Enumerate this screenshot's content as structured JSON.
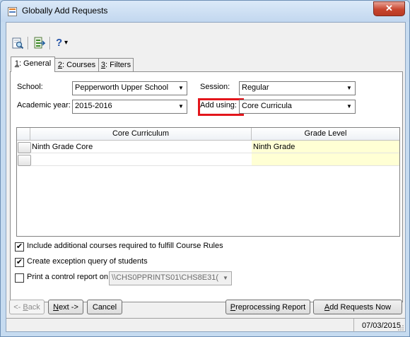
{
  "window": {
    "title": "Globally Add Requests",
    "close_glyph": "✕"
  },
  "toolbar": {
    "help_glyph": "?",
    "help_dropdown_glyph": "▾"
  },
  "tabs": [
    {
      "hotkey": "1",
      "label": ": General"
    },
    {
      "hotkey": "2",
      "label": ": Courses"
    },
    {
      "hotkey": "3",
      "label": ": Filters"
    }
  ],
  "form": {
    "school_label": "School:",
    "school_value": "Pepperworth Upper School",
    "session_label": "Session:",
    "session_value": "Regular",
    "academic_year_label": "Academic year:",
    "academic_year_value": "2015-2016",
    "add_using_label": "Add using:",
    "add_using_value": "Core Curricula"
  },
  "grid": {
    "columns": [
      "Core Curriculum",
      "Grade Level"
    ],
    "rows": [
      {
        "core": "Ninth Grade Core",
        "grade": "Ninth Grade"
      },
      {
        "core": "",
        "grade": ""
      }
    ]
  },
  "options": [
    {
      "label": "Include additional courses required to fulfill Course Rules",
      "checked": true
    },
    {
      "label": "Create exception query of students",
      "checked": true
    },
    {
      "label": "Print a control report on",
      "checked": false
    }
  ],
  "printer": {
    "value": "\\\\CHS0PPRINTS01\\CHS8E31("
  },
  "buttons": {
    "back_hotkey": "B",
    "back_prefix": "<- ",
    "back_rest": "ack",
    "next_hotkey": "N",
    "next_rest": "ext ->",
    "cancel": "Cancel",
    "preprocess_hotkey": "P",
    "preprocess_rest": "reprocessing Report",
    "add_hotkey": "A",
    "add_rest": "dd Requests Now"
  },
  "status": {
    "date": "07/03/2015"
  },
  "colors": {
    "highlight": "#e3161c",
    "grade_cell": "#ffffd4",
    "close": "#c8452e"
  },
  "icons": [
    "preview-icon",
    "export-icon",
    "help-icon"
  ]
}
